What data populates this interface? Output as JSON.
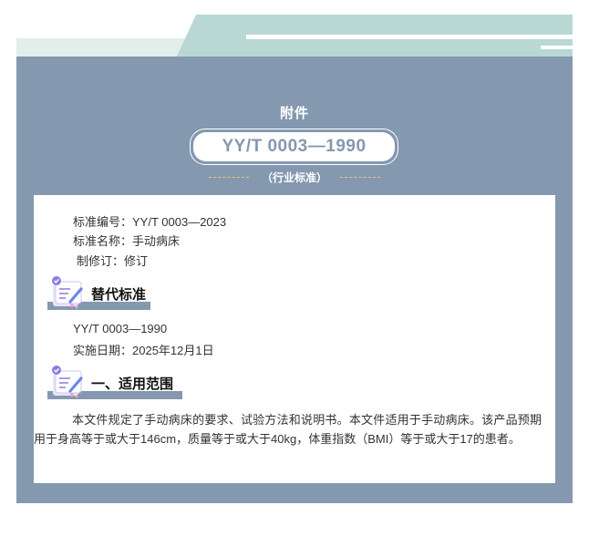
{
  "header": {
    "attachment_label": "附件",
    "standard_code": "YY/T 0003—1990",
    "category": "（行业标准）"
  },
  "meta": {
    "number_line": "标准编号：YY/T 0003—2023",
    "name_line": "标准名称：手动病床",
    "revision_line": "制修订：修订"
  },
  "sections": [
    {
      "title": "替代标准",
      "lines": [
        "YY/T 0003—1990",
        "实施日期：2025年12月1日"
      ]
    },
    {
      "title": "一、适用范围",
      "paragraph": "本文件规定了手动病床的要求、试验方法和说明书。本文件适用于手动病床。该产品预期用于身高等于或大于146cm，质量等于或大于40kg，体重指数（BMI）等于或大于17的患者。"
    }
  ],
  "colors": {
    "panel": "#8498af",
    "top_band_teal": "#b9d8d4",
    "top_band_light": "#e1eeec",
    "dash_gold": "#e2cd84",
    "icon_purple": "#8f7be0"
  },
  "icons": [
    "memo-pencil-icon"
  ]
}
